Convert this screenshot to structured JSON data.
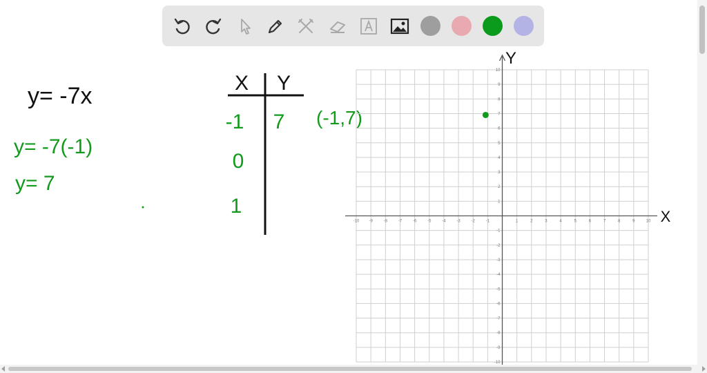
{
  "toolbar": {
    "tools": [
      "undo-icon",
      "redo-icon",
      "pointer-icon",
      "pen-icon",
      "tools-icon",
      "eraser-icon",
      "text-icon",
      "image-icon"
    ],
    "colors": [
      "#9e9e9e",
      "#e8a9b0",
      "#0b9b1c",
      "#b3b3e6"
    ]
  },
  "whiteboard": {
    "equation": "y= -7x",
    "work_line1": "y= -7(-1)",
    "work_line2": "y= 7",
    "table": {
      "header_x": "X",
      "header_y": "Y",
      "rows": [
        {
          "x": "-1",
          "y": "7"
        },
        {
          "x": "0",
          "y": ""
        },
        {
          "x": "1",
          "y": ""
        }
      ]
    },
    "point_label": "(-1,7)",
    "axis_x_label": "X",
    "axis_y_label": "Y",
    "ink_black": "#111111",
    "ink_green": "#129a1c"
  },
  "chart_data": {
    "type": "scatter",
    "xlim": [
      -10,
      10
    ],
    "ylim": [
      -10,
      10
    ],
    "xlabel": "X",
    "ylabel": "Y",
    "grid": true,
    "x_ticks": [
      -10,
      -9,
      -8,
      -7,
      -6,
      -5,
      -4,
      -3,
      -2,
      -1,
      1,
      2,
      3,
      4,
      5,
      6,
      7,
      8,
      9,
      10
    ],
    "y_ticks": [
      -10,
      -9,
      -8,
      -7,
      -6,
      -5,
      -4,
      -3,
      -2,
      -1,
      1,
      2,
      3,
      4,
      5,
      6,
      7,
      8,
      9,
      10
    ],
    "points": [
      {
        "x": -1,
        "y": 7,
        "label": "(-1,7)"
      }
    ]
  }
}
